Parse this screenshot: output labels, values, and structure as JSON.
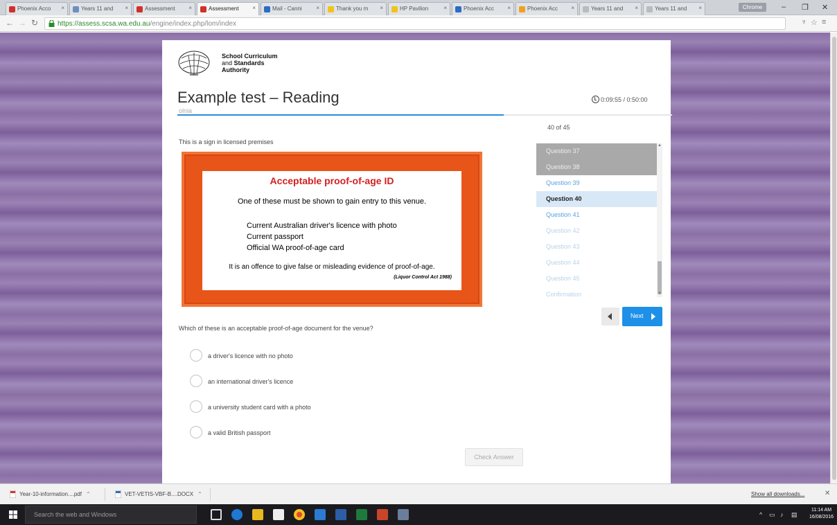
{
  "browser": {
    "tabs": [
      {
        "label": "Phoenix Acco",
        "color": "#d1302a"
      },
      {
        "label": "Years 11 and",
        "color": "#6d8fbf"
      },
      {
        "label": "Assessment",
        "color": "#d1302a"
      },
      {
        "label": "Assessment",
        "color": "#d1302a",
        "active": true
      },
      {
        "label": "Mail - Canni",
        "color": "#2b6cc4"
      },
      {
        "label": "Thank you m",
        "color": "#f0c419"
      },
      {
        "label": "HP Pavilion",
        "color": "#f0c419"
      },
      {
        "label": "Phoenix Acc",
        "color": "#2b6cc4"
      },
      {
        "label": "Phoenix Acc",
        "color": "#f0a020"
      },
      {
        "label": "Years 11 and",
        "color": "#bbbbbb"
      },
      {
        "label": "Years 11 and",
        "color": "#bbbbbb"
      }
    ],
    "profile_label": "Chrome",
    "url_scheme": "https://",
    "url_host": "assess.scsa.wa.edu.au",
    "url_path": "/engine/index.php/lom/index"
  },
  "test": {
    "org_line1": "School Curriculum",
    "org_line2": "and",
    "org_line2_bold": "Standards",
    "org_line3": "Authority",
    "title": "Example test – Reading",
    "subtitle": "olnia",
    "timer": "0:09:55 / 0:50:00",
    "progress_fraction": 0.66,
    "stimulus_text": "This is a sign in licensed premises",
    "sign": {
      "title": "Acceptable proof-of-age ID",
      "lead": "One of these must be shown to gain entry to this venue.",
      "items": [
        "Current Australian driver's licence with photo",
        "Current passport",
        "Official WA proof-of-age card"
      ],
      "warning": "It is an offence to give false or misleading evidence of proof-of-age.",
      "act": "(Liquor Control Act 1988)"
    },
    "question": "Which of these is an acceptable proof-of-age document for the venue?",
    "options": [
      "a driver's licence with no photo",
      "an international driver's licence",
      "a university student card with a photo",
      "a valid British passport"
    ],
    "check_label": "Check Answer"
  },
  "navigator": {
    "count": "40 of 45",
    "items": [
      {
        "label": "Question 37",
        "state": "done"
      },
      {
        "label": "Question 38",
        "state": "done"
      },
      {
        "label": "Question 39",
        "state": "open"
      },
      {
        "label": "Question 40",
        "state": "current"
      },
      {
        "label": "Question 41",
        "state": "open"
      },
      {
        "label": "Question 42",
        "state": "faded"
      },
      {
        "label": "Question 43",
        "state": "faded"
      },
      {
        "label": "Question 44",
        "state": "faded"
      },
      {
        "label": "Question 45",
        "state": "faded"
      },
      {
        "label": "Confirmation",
        "state": "faded"
      }
    ],
    "next_label": "Next"
  },
  "downloads": {
    "items": [
      "Year-10-information....pdf",
      "VET-VETIS-VBF-B....DOCX"
    ],
    "show_all": "Show all downloads..."
  },
  "taskbar": {
    "search_placeholder": "Search the web and Windows",
    "time": "11:14 AM",
    "date": "16/08/2016"
  }
}
